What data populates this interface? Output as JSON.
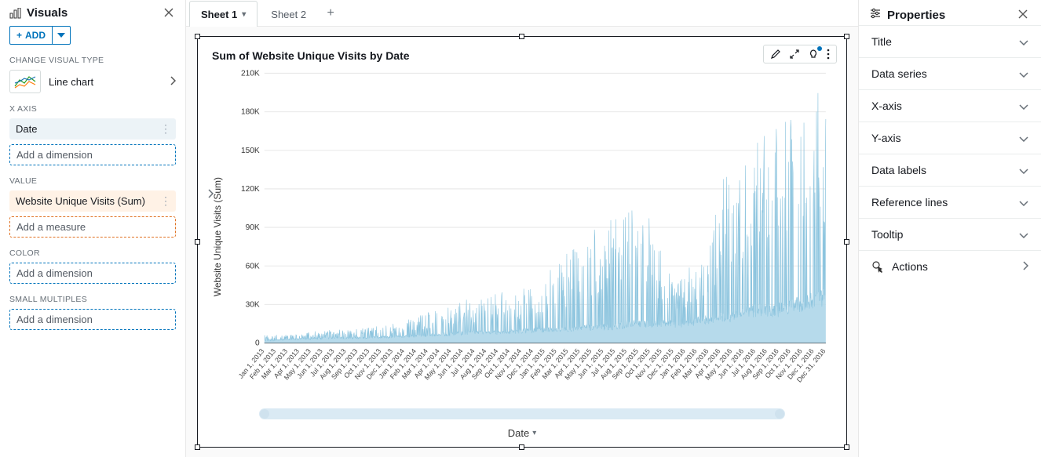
{
  "left": {
    "title": "Visuals",
    "add_label": "ADD",
    "change_label": "CHANGE VISUAL TYPE",
    "visual_type": "Line chart",
    "sections": {
      "xaxis": "X AXIS",
      "value": "VALUE",
      "color": "COLOR",
      "small_multiples": "SMALL MULTIPLES"
    },
    "xaxis_field": "Date",
    "value_field": "Website Unique Visits (Sum)",
    "add_dimension": "Add a dimension",
    "add_measure": "Add a measure"
  },
  "tabs": {
    "t1": "Sheet 1",
    "t2": "Sheet 2"
  },
  "chart": {
    "title": "Sum of Website Unique Visits by Date",
    "xlabel": "Date",
    "ylabel": "Website Unique Visits (Sum)"
  },
  "right": {
    "title": "Properties",
    "items": [
      "Title",
      "Data series",
      "X-axis",
      "Y-axis",
      "Data labels",
      "Reference lines",
      "Tooltip"
    ],
    "actions": "Actions"
  },
  "chart_data": {
    "type": "line",
    "title": "Sum of Website Unique Visits by Date",
    "xlabel": "Date",
    "ylabel": "Website Unique Visits (Sum)",
    "ylim": [
      0,
      210000
    ],
    "y_ticks": [
      0,
      30000,
      60000,
      90000,
      120000,
      150000,
      180000,
      210000
    ],
    "y_tick_labels": [
      "0",
      "30K",
      "60K",
      "90K",
      "120K",
      "150K",
      "180K",
      "210K"
    ],
    "x_tick_labels": [
      "Jan 1, 2013",
      "Feb 1, 2013",
      "Mar 1, 2013",
      "Apr 1, 2013",
      "May 1, 2013",
      "Jun 1, 2013",
      "Jul 1, 2013",
      "Aug 1, 2013",
      "Sep 1, 2013",
      "Oct 1, 2013",
      "Nov 1, 2013",
      "Dec 1, 2013",
      "Jan 1, 2014",
      "Feb 1, 2014",
      "Mar 1, 2014",
      "Apr 1, 2014",
      "May 1, 2014",
      "Jun 1, 2014",
      "Jul 1, 2014",
      "Aug 1, 2014",
      "Sep 1, 2014",
      "Oct 1, 2014",
      "Nov 1, 2014",
      "Dec 1, 2014",
      "Jan 1, 2015",
      "Feb 1, 2015",
      "Mar 1, 2015",
      "Apr 1, 2015",
      "May 1, 2015",
      "Jun 1, 2015",
      "Jul 1, 2015",
      "Aug 1, 2015",
      "Sep 1, 2015",
      "Oct 1, 2015",
      "Nov 1, 2015",
      "Dec 1, 2015",
      "Jan 1, 2016",
      "Feb 1, 2016",
      "Mar 1, 2016",
      "Apr 1, 2016",
      "May 1, 2016",
      "Jun 1, 2016",
      "Jul 1, 2016",
      "Aug 1, 2016",
      "Sep 1, 2016",
      "Oct 1, 2016",
      "Nov 1, 2016",
      "Dec 1, 2016",
      "Dec 31, 2016"
    ],
    "approx_monthly_range": [
      {
        "month": "2013-01",
        "low": 2000,
        "high": 6000
      },
      {
        "month": "2013-03",
        "low": 3000,
        "high": 8000
      },
      {
        "month": "2013-06",
        "low": 4000,
        "high": 10000
      },
      {
        "month": "2013-09",
        "low": 4000,
        "high": 12000
      },
      {
        "month": "2013-12",
        "low": 5000,
        "high": 15000
      },
      {
        "month": "2014-03",
        "low": 6000,
        "high": 25000
      },
      {
        "month": "2014-06",
        "low": 8000,
        "high": 35000
      },
      {
        "month": "2014-09",
        "low": 8000,
        "high": 40000
      },
      {
        "month": "2014-12",
        "low": 10000,
        "high": 45000
      },
      {
        "month": "2015-02",
        "low": 10000,
        "high": 70000
      },
      {
        "month": "2015-04",
        "low": 12000,
        "high": 80000
      },
      {
        "month": "2015-06",
        "low": 12000,
        "high": 100000
      },
      {
        "month": "2015-08",
        "low": 15000,
        "high": 125000
      },
      {
        "month": "2015-10",
        "low": 15000,
        "high": 80000
      },
      {
        "month": "2015-12",
        "low": 15000,
        "high": 50000
      },
      {
        "month": "2016-02",
        "low": 18000,
        "high": 80000
      },
      {
        "month": "2016-04",
        "low": 20000,
        "high": 130000
      },
      {
        "month": "2016-06",
        "low": 25000,
        "high": 160000
      },
      {
        "month": "2016-08",
        "low": 25000,
        "high": 170000
      },
      {
        "month": "2016-10",
        "low": 30000,
        "high": 180000
      },
      {
        "month": "2016-12",
        "low": 35000,
        "high": 195000
      }
    ],
    "note": "Daily series Jan 1 2013 – Dec 31 2016, highly spiky. Values estimated from gridlines; precise daily values not labeled."
  }
}
